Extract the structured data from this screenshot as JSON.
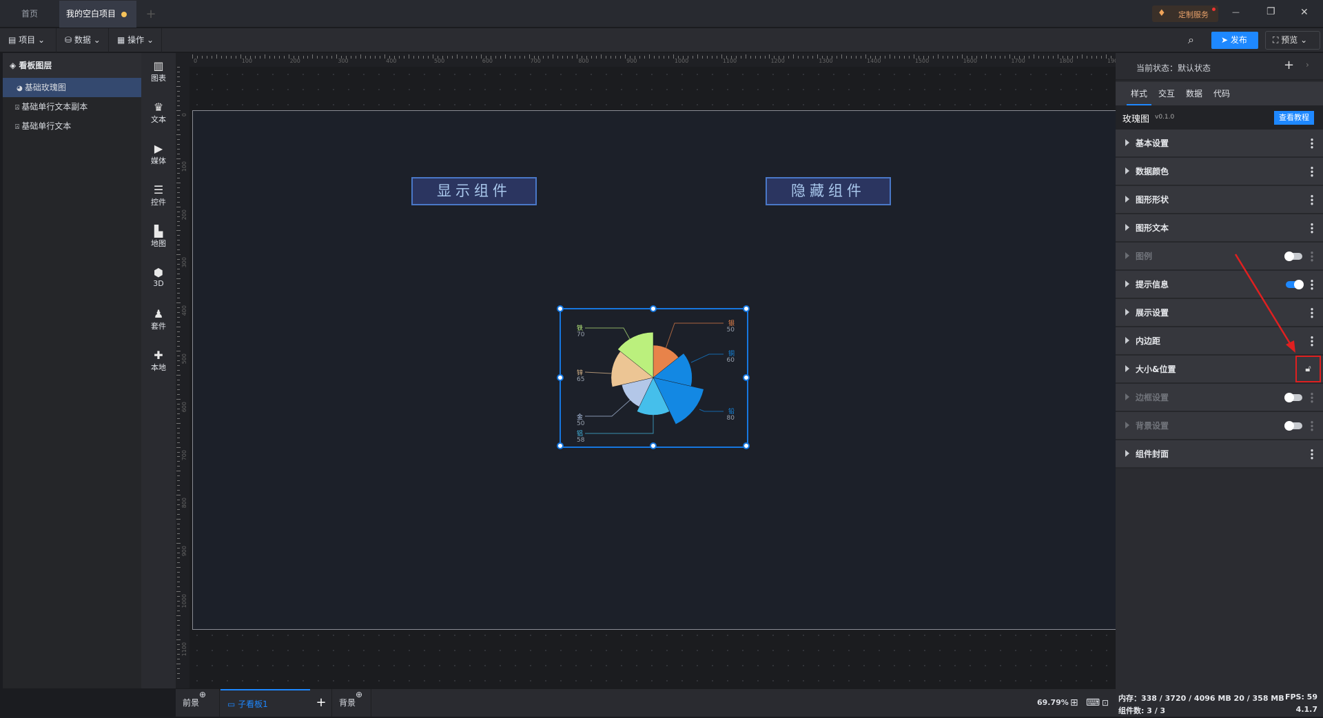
{
  "tabs": [
    {
      "label": "首页"
    },
    {
      "label": "我的空白项目",
      "modified": true
    }
  ],
  "window": {
    "service_label": "定制服务",
    "minimize": "—",
    "restore": "❐",
    "close": "✕"
  },
  "toolbar": {
    "menus": [
      {
        "label": "项目",
        "icon": "file-icon"
      },
      {
        "label": "数据",
        "icon": "database-icon"
      },
      {
        "label": "操作",
        "icon": "grid-icon"
      }
    ],
    "publish": "发布",
    "preview": "预览"
  },
  "layers": {
    "title": "看板图层",
    "items": [
      {
        "label": "基础玫瑰图",
        "selected": true
      },
      {
        "label": "基础单行文本副本"
      },
      {
        "label": "基础单行文本"
      }
    ]
  },
  "iconbar": [
    {
      "label": "图表",
      "glyph": "▥"
    },
    {
      "label": "文本",
      "glyph": "♛"
    },
    {
      "label": "媒体",
      "glyph": "▶"
    },
    {
      "label": "控件",
      "glyph": "☰"
    },
    {
      "label": "地图",
      "glyph": "▙"
    },
    {
      "label": "3D",
      "glyph": "⬢"
    },
    {
      "label": "套件",
      "glyph": "♟"
    },
    {
      "label": "本地",
      "glyph": "✚"
    }
  ],
  "ruler": {
    "h": [
      0,
      100,
      200,
      300,
      400,
      500,
      600,
      700,
      800,
      900,
      1000,
      1100,
      1200,
      1300,
      1400,
      1500,
      1600,
      1700,
      1800,
      1900
    ],
    "v": [
      0,
      100,
      200,
      300,
      400,
      500,
      600,
      700,
      800,
      900,
      1000,
      1100
    ]
  },
  "canvas": {
    "show_button": "显示组件",
    "hide_button": "隐藏组件"
  },
  "chart_data": {
    "type": "rose",
    "categories": [
      "银",
      "铜",
      "铅",
      "铝",
      "金",
      "锌",
      "铁"
    ],
    "values": [
      50,
      60,
      80,
      58,
      50,
      65,
      70
    ],
    "colors": [
      "#e8834a",
      "#1388e3",
      "#1388e3",
      "#45bfeb",
      "#b3c7e8",
      "#ecc594",
      "#bbf07d"
    ]
  },
  "bottom": {
    "front": "前景",
    "board": "子看板1",
    "add": "+",
    "back": "背景",
    "zoom": "69.79%"
  },
  "right": {
    "state_label": "当前状态：默认状态",
    "tabs": [
      "样式",
      "交互",
      "数据",
      "代码"
    ],
    "component": "玫瑰图",
    "version": "v0.1.0",
    "tutorial": "查看教程",
    "sections": [
      {
        "label": "基本设置"
      },
      {
        "label": "数据颜色"
      },
      {
        "label": "图形形状"
      },
      {
        "label": "图形文本"
      },
      {
        "label": "图例",
        "toggle": false,
        "disabled": true
      },
      {
        "label": "提示信息",
        "toggle": true
      },
      {
        "label": "展示设置"
      },
      {
        "label": "内边距"
      },
      {
        "label": "大小&位置",
        "lock": true
      },
      {
        "label": "边框设置",
        "toggle": false,
        "disabled": true
      },
      {
        "label": "背景设置",
        "toggle": false,
        "disabled": true
      },
      {
        "label": "组件封面"
      }
    ]
  },
  "status": {
    "memory": "内存：338 / 3720 / 4096 MB  20 / 358 MB",
    "fps": "FPS:  59",
    "components": "组件数: 3 / 3",
    "version": "4.1.7"
  },
  "colors": {
    "accent": "#1e88ff",
    "selection": "#1677e0",
    "annotation": "#e02020"
  }
}
